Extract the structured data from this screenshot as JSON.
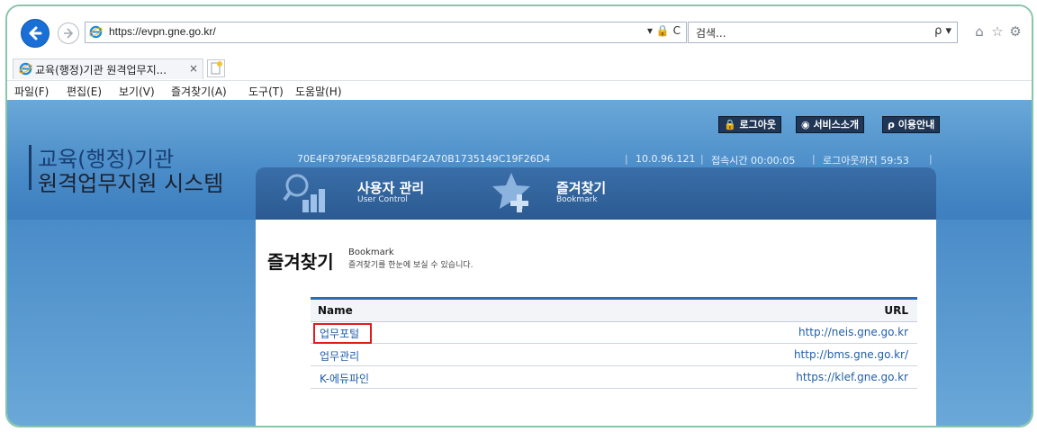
{
  "browser": {
    "url": "https://evpn.gne.go.kr/",
    "url_host_bold": "gne.go.kr",
    "search_placeholder": "검색...",
    "tab_title": "교육(행정)기관 원격업무지...",
    "tab_close": "×",
    "url_tools": "▾ 🔒 C",
    "search_icon": "ρ ▾",
    "toolbar_icons": [
      "home-icon",
      "star-icon",
      "gear-icon"
    ],
    "menu": [
      "파일(F)",
      "편집(E)",
      "보기(V)",
      "즐겨찾기(A)",
      "도구(T)",
      "도움말(H)"
    ]
  },
  "header": {
    "title_line1": "교육(행정)기관",
    "title_line2": "원격업무지원 시스템",
    "buttons": [
      "로그아웃",
      "서비스소개",
      "이용안내"
    ],
    "session_id": "70E4F979FAE9582BFD4F2A70B1735149C19F26D4",
    "ip": "10.0.96.121",
    "connect_time": "접속시간 00:00:05",
    "logout_time": "로그아웃까지 59:53"
  },
  "nav": [
    {
      "title": "사용자 관리",
      "subtitle": "User Control"
    },
    {
      "title": "즐겨찾기",
      "subtitle": "Bookmark"
    }
  ],
  "content": {
    "title": "즐겨찾기",
    "title_en": "Bookmark",
    "description": "즐겨찾기를 한눈에 보실 수 있습니다.",
    "columns": {
      "name": "Name",
      "url": "URL"
    },
    "rows": [
      {
        "name": "업무포털",
        "url": "http://neis.gne.go.kr"
      },
      {
        "name": "업무관리",
        "url": "http://bms.gne.go.kr/"
      },
      {
        "name": "K-에듀파인",
        "url": "https://klef.gne.go.kr"
      }
    ]
  },
  "colors": {
    "accent": "#2f6cb8",
    "highlight": "#e21a1a",
    "header_bg": "#4a8cc8"
  }
}
